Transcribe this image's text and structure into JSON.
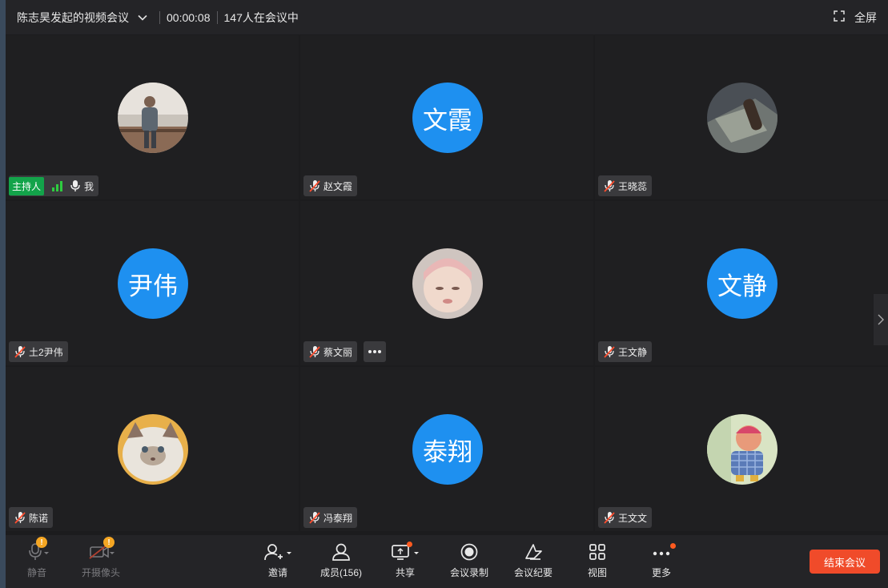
{
  "titlebar": {
    "meeting_title": "陈志昊发起的视频会议",
    "timer": "00:00:08",
    "participant_count": "147人在会议中",
    "fullscreen_label": "全屏"
  },
  "tiles": [
    {
      "avatar_text": "",
      "name": "我",
      "host_label": "主持人",
      "muted": false
    },
    {
      "avatar_text": "文霞",
      "name": "赵文霞",
      "muted": true
    },
    {
      "avatar_text": "",
      "name": "王晓蕊",
      "muted": true
    },
    {
      "avatar_text": "尹伟",
      "name": "土2尹伟",
      "muted": true
    },
    {
      "avatar_text": "",
      "name": "蔡文丽",
      "muted": true
    },
    {
      "avatar_text": "文静",
      "name": "王文静",
      "muted": true
    },
    {
      "avatar_text": "",
      "name": "陈诺",
      "muted": true
    },
    {
      "avatar_text": "泰翔",
      "name": "冯泰翔",
      "muted": true
    },
    {
      "avatar_text": "",
      "name": "王文文",
      "muted": true
    }
  ],
  "toolbar": {
    "mute_label": "静音",
    "camera_label": "开摄像头",
    "invite_label": "邀请",
    "members_label": "成员(156)",
    "share_label": "共享",
    "record_label": "会议录制",
    "minutes_label": "会议纪要",
    "view_label": "视图",
    "more_label": "更多",
    "end_label": "结束会议",
    "warning_mark": "!"
  },
  "colors": {
    "avatar_blue": "#1e90f0",
    "host_green": "#13a34a",
    "end_red": "#f04b2a",
    "warning_orange": "#f5a623"
  }
}
